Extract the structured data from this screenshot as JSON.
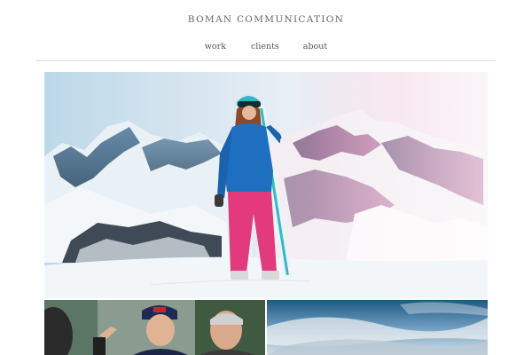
{
  "site": {
    "title": "BOMAN COMMUNICATION"
  },
  "nav": {
    "items": [
      "work",
      "clients",
      "about"
    ]
  },
  "images": {
    "hero": "skier-on-mountain-photo",
    "bottom_left": "racers-portrait-photo",
    "bottom_right": "sky-clouds-photo"
  },
  "colors": {
    "background": "#ffffff",
    "text": "#555555",
    "divider": "#dcdcdc"
  }
}
